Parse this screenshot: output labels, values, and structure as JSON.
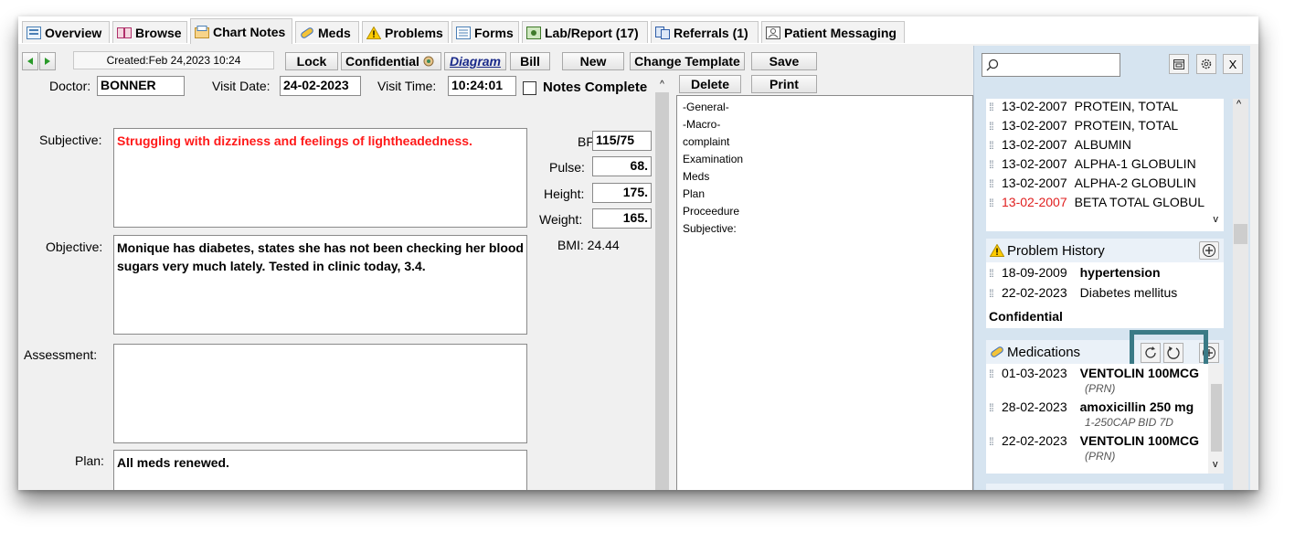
{
  "tabs": [
    {
      "label": "Overview"
    },
    {
      "label": "Browse"
    },
    {
      "label": "Chart Notes"
    },
    {
      "label": "Meds"
    },
    {
      "label": "Problems"
    },
    {
      "label": "Forms"
    },
    {
      "label": "Lab/Report (17)"
    },
    {
      "label": "Referrals (1)"
    },
    {
      "label": "Patient Messaging"
    }
  ],
  "toolbar": {
    "created": "Created:Feb 24,2023 10:24",
    "lock": "Lock",
    "confidential": "Confidential",
    "diagram": "Diagram",
    "bill": "Bill",
    "new": "New",
    "change_template": "Change Template",
    "save": "Save",
    "delete": "Delete",
    "print": "Print"
  },
  "visit": {
    "doctor_label": "Doctor:",
    "doctor": "BONNER",
    "date_label": "Visit Date:",
    "date": "24-02-2023",
    "time_label": "Visit Time:",
    "time": "10:24:01",
    "notes_complete": "Notes Complete"
  },
  "note": {
    "subjective_label": "Subjective:",
    "subjective": "Struggling with dizziness and feelings of lightheadedness.",
    "objective_label": "Objective:",
    "objective": "Monique has diabetes, states she has not been checking her blood sugars very much lately. Tested in clinic today, 3.4.",
    "assessment_label": "Assessment:",
    "assessment": "",
    "plan_label": "Plan:",
    "plan": "All meds renewed."
  },
  "vitals": {
    "bp_label": "BP:",
    "bp": "115/75",
    "pulse_label": "Pulse:",
    "pulse": "68.",
    "height_label": "Height:",
    "height": "175.",
    "weight_label": "Weight:",
    "weight": "165.",
    "bmi": "BMI: 24.44"
  },
  "templates": [
    "-General-",
    "-Macro-",
    "complaint",
    "Examination",
    "Meds",
    "Plan",
    "Proceedure",
    "Subjective:"
  ],
  "labs": [
    {
      "date": "13-02-2007",
      "name": "PROTEIN, TOTAL",
      "abnormal": false
    },
    {
      "date": "13-02-2007",
      "name": "PROTEIN, TOTAL",
      "abnormal": false
    },
    {
      "date": "13-02-2007",
      "name": "ALBUMIN",
      "abnormal": false
    },
    {
      "date": "13-02-2007",
      "name": "ALPHA-1 GLOBULIN",
      "abnormal": false
    },
    {
      "date": "13-02-2007",
      "name": "ALPHA-2 GLOBULIN",
      "abnormal": false
    },
    {
      "date": "13-02-2007",
      "name": "BETA TOTAL GLOBUL",
      "abnormal": true
    }
  ],
  "problem_history": {
    "title": "Problem History",
    "items": [
      {
        "date": "18-09-2009",
        "name": "hypertension"
      },
      {
        "date": "22-02-2023",
        "name": "Diabetes mellitus"
      }
    ],
    "footer": "Confidential"
  },
  "medications": {
    "title": "Medications",
    "items": [
      {
        "date": "01-03-2023",
        "name": "VENTOLIN 100MCG",
        "sig": "(PRN)"
      },
      {
        "date": "28-02-2023",
        "name": "amoxicillin 250 mg",
        "sig": "1-250CAP BID 7D"
      },
      {
        "date": "22-02-2023",
        "name": "VENTOLIN 100MCG",
        "sig": "(PRN)"
      }
    ]
  },
  "search": {
    "placeholder": "",
    "value": ""
  },
  "colors": {
    "abnormal": "#e02020",
    "subjective": "#ff0000",
    "highlight": "#3a7a86"
  }
}
